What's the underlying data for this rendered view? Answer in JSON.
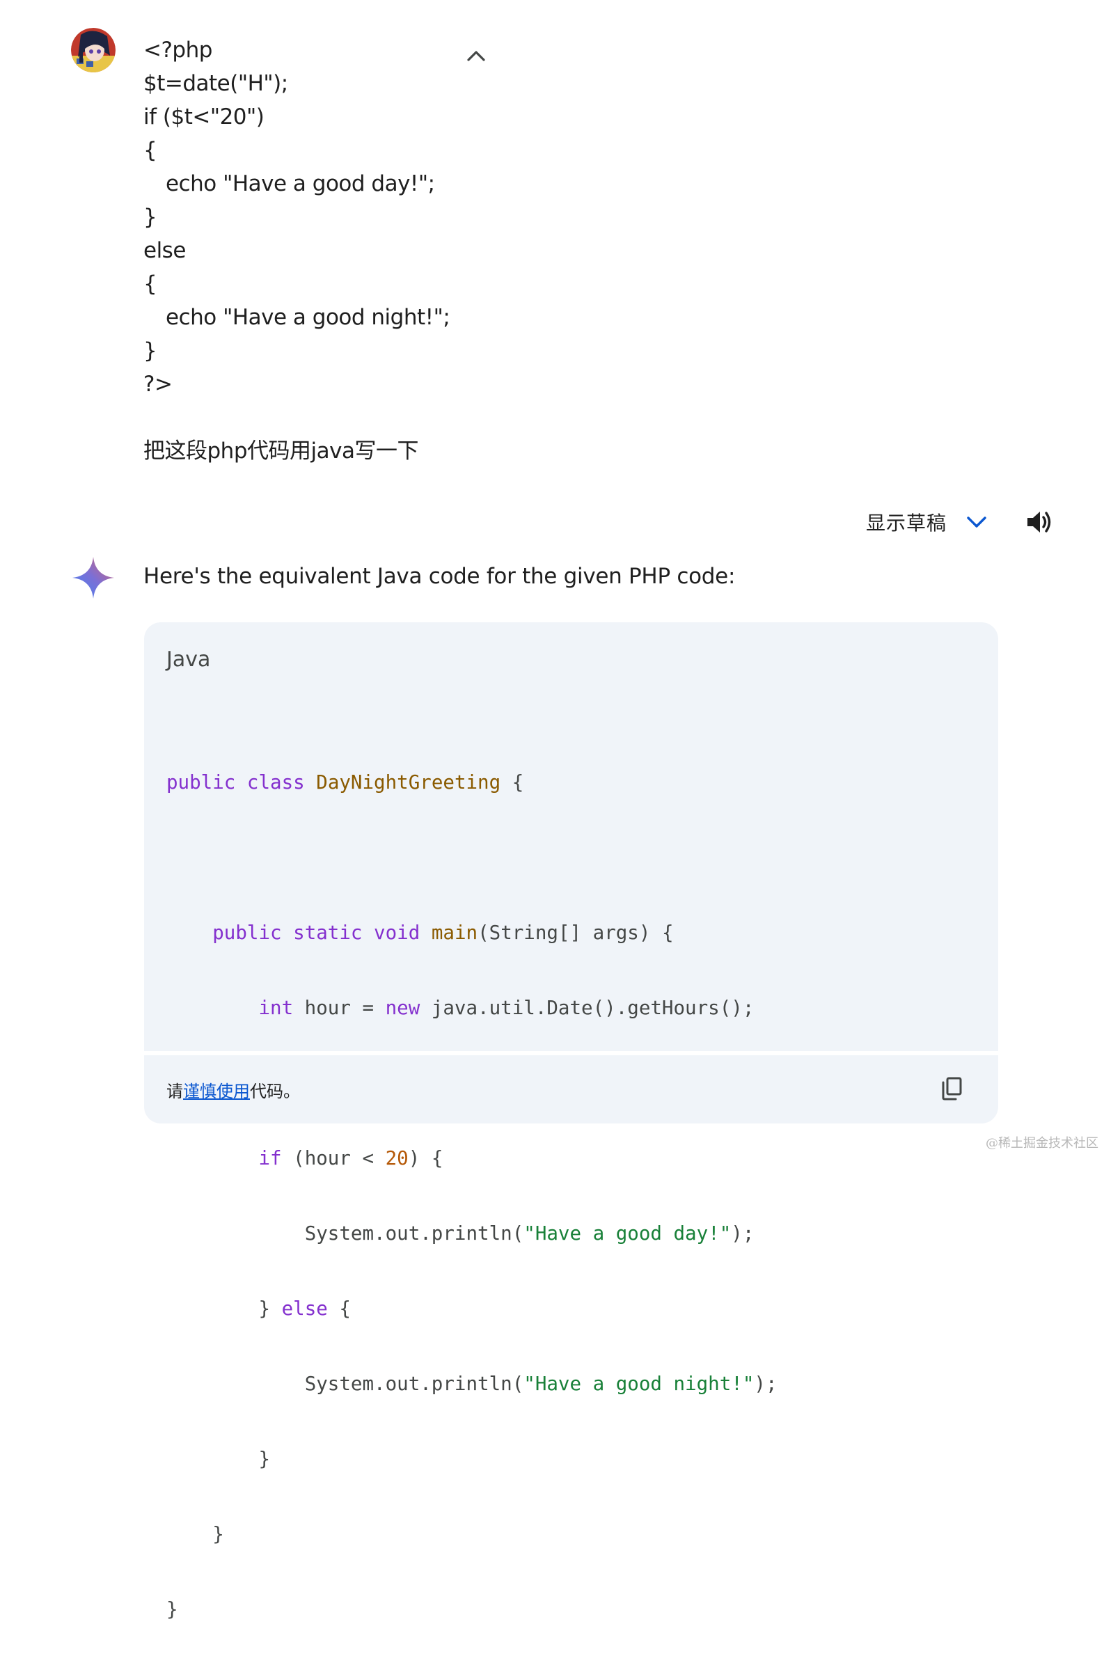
{
  "user_message": {
    "code_lines": [
      "<?php",
      "$t=date(\"H\");",
      "if ($t<\"20\")",
      "{",
      "echo \"Have a good day!\";",
      "}",
      "else",
      "{",
      "echo \"Have a good night!\";",
      "}",
      "?>"
    ],
    "prompt": "把这段php代码用java写一下"
  },
  "response": {
    "drafts_label": "显示草稿",
    "intro": "Here's the equivalent Java code for the given PHP code:",
    "code_block": {
      "language": "Java",
      "tokens": {
        "l1_public": "public",
        "l1_class": "class",
        "l1_name": "DayNightGreeting",
        "l1_rest": " {",
        "l3_public": "public",
        "l3_static": "static",
        "l3_void": "void",
        "l3_main": "main",
        "l3_rest": "(String[] args) {",
        "l4_int": "int",
        "l4_mid": " hour = ",
        "l4_new": "new",
        "l4_rest": " java.util.Date().getHours();",
        "l6_if": "if",
        "l6_mid": " (hour < ",
        "l6_num": "20",
        "l6_rest": ") {",
        "l7_pre": "System.out.println(",
        "l7_str": "\"Have a good day!\"",
        "l7_rest": ");",
        "l8_pre": "} ",
        "l8_else": "else",
        "l8_rest": " {",
        "l9_pre": "System.out.println(",
        "l9_str": "\"Have a good night!\"",
        "l9_rest": ");",
        "l10": "}",
        "l11": "}",
        "l12": "}"
      }
    },
    "footer": {
      "prefix": "请",
      "link": "谨慎使用",
      "suffix": "代码。"
    }
  },
  "colors": {
    "code_background": "#f0f4f9",
    "keyword": "#8430ce",
    "type_name": "#8a5a00",
    "string": "#188038",
    "number": "#b55908",
    "link": "#0b57d0",
    "drafts_chevron": "#0b57d0"
  },
  "icons": {
    "collapse": "chevron-up-icon",
    "drafts": "chevron-down-icon",
    "speaker": "speaker-icon",
    "copy": "copy-icon",
    "assistant": "gemini-sparkle-icon"
  },
  "watermark": "@稀土掘金技术社区"
}
